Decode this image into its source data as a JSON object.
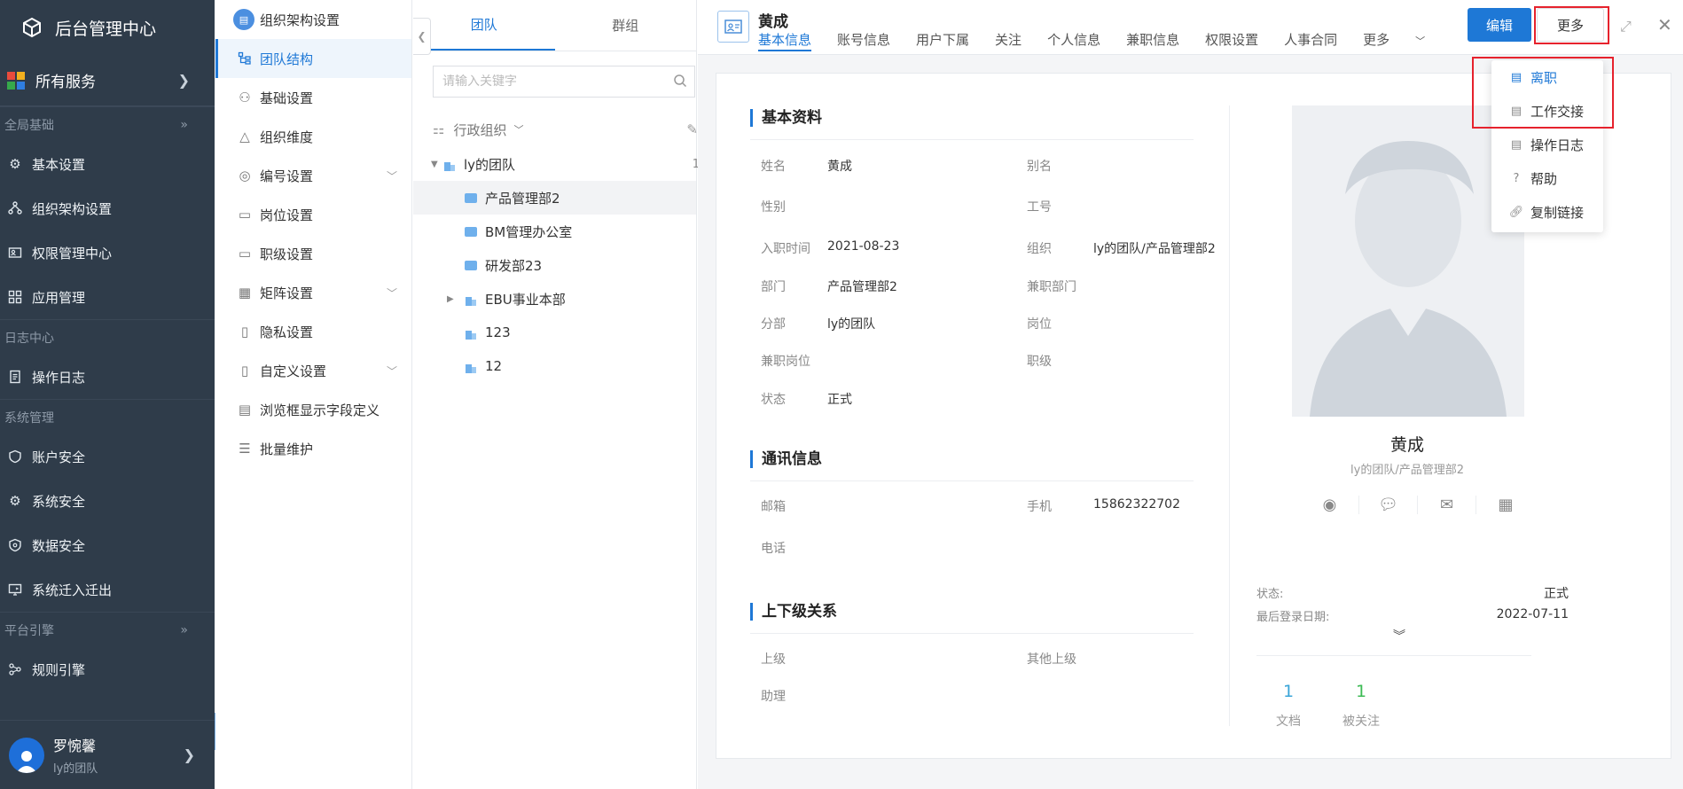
{
  "nav": {
    "brand": "后台管理中心",
    "all_services": "所有服务",
    "sections": [
      {
        "title": "全局基础"
      },
      {
        "title": "日志中心"
      },
      {
        "title": "系统管理"
      },
      {
        "title": "平台引擎"
      }
    ],
    "items": {
      "basic_settings": "基本设置",
      "org_settings": "组织架构设置",
      "permission_center": "权限管理中心",
      "app_management": "应用管理",
      "operation_log": "操作日志",
      "account_security": "账户安全",
      "system_security": "系统安全",
      "data_security": "数据安全",
      "system_migration": "系统迁入迁出",
      "rule_engine": "规则引擎"
    },
    "user": {
      "name": "罗惋馨",
      "team": "ly的团队"
    }
  },
  "submenu": {
    "title": "组织架构设置",
    "items": [
      "团队结构",
      "基础设置",
      "组织维度",
      "编号设置",
      "岗位设置",
      "职级设置",
      "矩阵设置",
      "隐私设置",
      "自定义设置",
      "浏览框显示字段定义",
      "批量维护"
    ]
  },
  "tree": {
    "tabs": [
      "团队",
      "群组"
    ],
    "search_placeholder": "请输入关键字",
    "org_selector": "行政组织",
    "root": "ly的团队",
    "root_count": "1",
    "nodes": [
      "产品管理部2",
      "BM管理办公室",
      "研发部23",
      "EBU事业本部",
      "123",
      "12"
    ]
  },
  "detail": {
    "name": "黄成",
    "tabs": [
      "基本信息",
      "账号信息",
      "用户下属",
      "关注",
      "个人信息",
      "兼职信息",
      "权限设置",
      "人事合同",
      "更多"
    ],
    "edit_label": "编辑",
    "more_label": "更多",
    "sections": {
      "basic": "基本资料",
      "contact": "通讯信息",
      "relation": "上下级关系"
    },
    "fields": {
      "name_label": "姓名",
      "name_value": "黄成",
      "alias_label": "别名",
      "gender_label": "性别",
      "emp_no_label": "工号",
      "join_date_label": "入职时间",
      "join_date_value": "2021-08-23",
      "org_label": "组织",
      "org_value": "ly的团队/产品管理部2",
      "dept_label": "部门",
      "dept_value": "产品管理部2",
      "parttime_dept_label": "兼职部门",
      "branch_label": "分部",
      "branch_value": "ly的团队",
      "post_label": "岗位",
      "parttime_post_label": "兼职岗位",
      "rank_label": "职级",
      "status_label": "状态",
      "status_value": "正式",
      "email_label": "邮箱",
      "mobile_label": "手机",
      "mobile_value": "15862322702",
      "phone_label": "电话",
      "superior_label": "上级",
      "other_superior_label": "其他上级",
      "assistant_label": "助理"
    },
    "profile": {
      "name": "黄成",
      "org": "ly的团队/产品管理部2",
      "status_label": "状态:",
      "status_value": "正式",
      "last_login_label": "最后登录日期:",
      "last_login_value": "2022-07-11",
      "docs_count": "1",
      "docs_label": "文档",
      "followed_count": "1",
      "followed_label": "被关注"
    }
  },
  "dropdown": {
    "items": [
      "离职",
      "工作交接",
      "操作日志",
      "帮助",
      "复制链接"
    ]
  },
  "colors": {
    "accent": "#1e78d6",
    "nav_bg": "#2f3c4a",
    "highlight_red": "#e6222d"
  }
}
